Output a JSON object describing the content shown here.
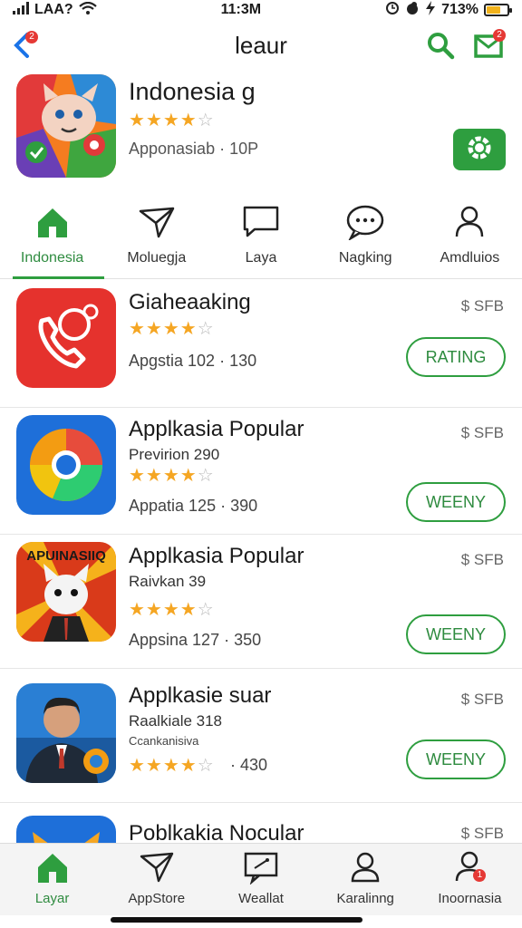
{
  "status_bar": {
    "carrier": "LAA?",
    "time": "11:3M",
    "battery": "713%",
    "battery_level": 0.7
  },
  "header": {
    "title": "leaur",
    "back_badge": "2",
    "mail_badge": "2"
  },
  "featured": {
    "title": "Indonesia g",
    "rating": 3.5,
    "meta": "Apponasiab · 10P"
  },
  "tabs": [
    {
      "label": "Indonesia",
      "icon": "home-icon",
      "active": true
    },
    {
      "label": "Moluegja",
      "icon": "paper-plane-icon",
      "active": false
    },
    {
      "label": "Laya",
      "icon": "message-box-icon",
      "active": false
    },
    {
      "label": "Nagking",
      "icon": "chat-bubble-icon",
      "active": false
    },
    {
      "label": "Amdluios",
      "icon": "person-icon",
      "active": false
    }
  ],
  "apps": [
    {
      "name": "Giaheaaking",
      "subtitle": "",
      "subtitle2": "",
      "rating": 4,
      "meta": "Apgstia 102 · 130",
      "price": "$ SFB",
      "button": "RATING",
      "icon": "phone-app-icon"
    },
    {
      "name": "Applkasia Popular",
      "subtitle": "Previrion 290",
      "subtitle2": "",
      "rating": 4,
      "meta": "Appatia 125 · 390",
      "price": "$ SFB",
      "button": "WEENY",
      "icon": "browser-app-icon"
    },
    {
      "name": "Applkasia Popular",
      "subtitle": "Raivkan 39",
      "subtitle2": "",
      "rating": 4,
      "meta": "Appsina 127 · 350",
      "price": "$ SFB",
      "button": "WEENY",
      "icon": "game-app-icon",
      "icon_text": "APUINASIIQ"
    },
    {
      "name": "Applkasie suar",
      "subtitle": "Raalkiale 318",
      "subtitle2": "Ccankanisiva",
      "rating": 4,
      "meta": "· 430",
      "price": "$ SFB",
      "button": "WEENY",
      "icon": "person-app-icon"
    },
    {
      "name": "Poblkakia Nocular",
      "subtitle": "",
      "subtitle2": "",
      "rating": 4,
      "meta": "",
      "price": "$ SFB",
      "button": "",
      "icon": "cat-app-icon"
    }
  ],
  "bottom_nav": [
    {
      "label": "Layar",
      "icon": "home-icon",
      "active": true
    },
    {
      "label": "AppStore",
      "icon": "paper-plane-icon",
      "active": false
    },
    {
      "label": "Weallat",
      "icon": "wallet-icon",
      "active": false
    },
    {
      "label": "Karalinng",
      "icon": "person-icon",
      "active": false
    },
    {
      "label": "Inoornasia",
      "icon": "profile-icon",
      "active": false,
      "badge": "1"
    }
  ],
  "colors": {
    "accent": "#2e9e3f",
    "star": "#f5a623",
    "badge": "#e53935",
    "link": "#1a73e8"
  }
}
